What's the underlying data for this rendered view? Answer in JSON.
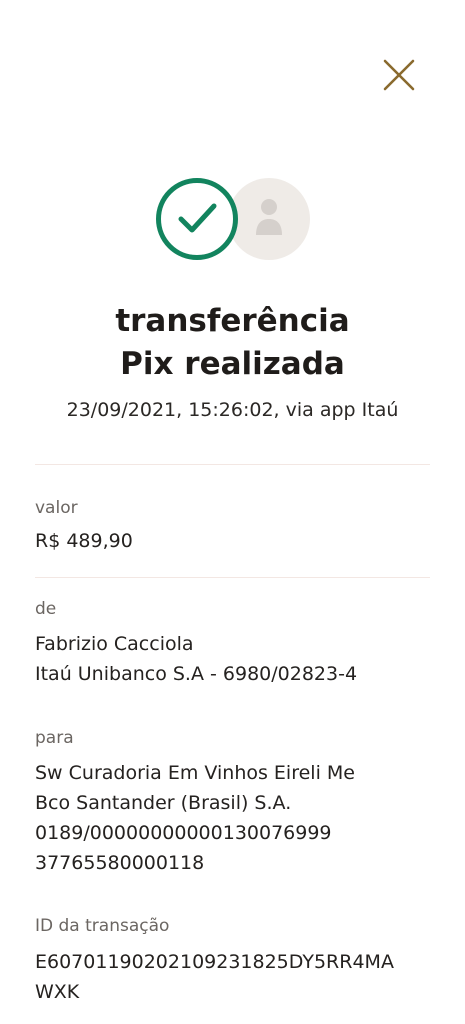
{
  "close": {
    "icon": "close-icon",
    "color": "#8A6A2E"
  },
  "status": {
    "success_icon": "check-icon",
    "avatar_icon": "person-icon",
    "success_color": "#12845E"
  },
  "header": {
    "title_line1": "transferência",
    "title_line2": "Pix realizada",
    "subtitle": "23/09/2021, 15:26:02, via app Itaú"
  },
  "valor": {
    "label": "valor",
    "amount": "R$ 489,90"
  },
  "de": {
    "label": "de",
    "name": "Fabrizio Cacciola",
    "bank": "Itaú Unibanco S.A - 6980/02823-4"
  },
  "para": {
    "label": "para",
    "name": "Sw Curadoria Em Vinhos Eireli Me",
    "bank": "Bco Santander (Brasil) S.A.",
    "account": "0189/00000000000130076999",
    "document": "37765580000118"
  },
  "transacao": {
    "label": "ID da transação",
    "id_line1": "E60701190202109231825DY5RR4MA",
    "id_line2": "WXK"
  }
}
